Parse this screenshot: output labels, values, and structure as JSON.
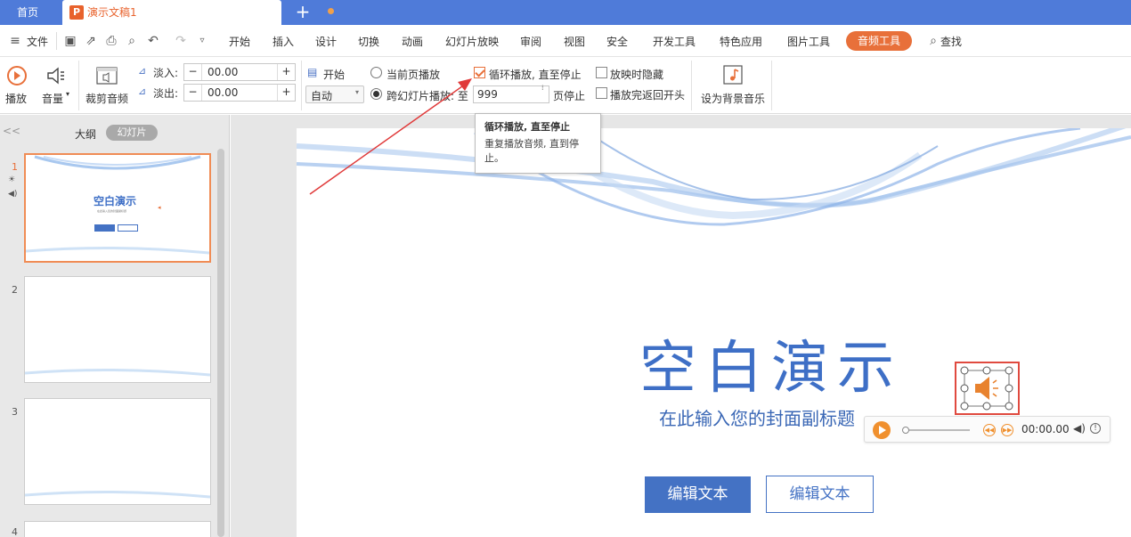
{
  "tabs": {
    "home": "首页",
    "doc_title": "演示文稿1",
    "add": "+"
  },
  "menu": {
    "file": "文件",
    "items": [
      "开始",
      "插入",
      "设计",
      "切换",
      "动画",
      "幻灯片放映",
      "审阅",
      "视图",
      "安全",
      "开发工具",
      "特色应用",
      "图片工具"
    ],
    "active_tab": "音频工具",
    "search": "查找"
  },
  "ribbon": {
    "play": "播放",
    "volume": "音量",
    "trim": "裁剪音频",
    "fade_in_label": "淡入:",
    "fade_in_value": "00.00",
    "fade_out_label": "淡出:",
    "fade_out_value": "00.00",
    "start_label": "开始",
    "start_value": "自动",
    "current_page": "当前页播放",
    "cross_slides": "跨幻灯片播放: 至",
    "cross_slides_value": "999",
    "page_stop": "页停止",
    "loop": "循环播放, 直至停止",
    "hide_during_show": "放映时隐藏",
    "rewind": "播放完返回开头",
    "set_bg_music": "设为背景音乐"
  },
  "tooltip": {
    "title": "循环播放, 直至停止",
    "desc": "重复播放音频, 直到停止。"
  },
  "left_panel": {
    "outline": "大纲",
    "slides": "幻灯片",
    "collapse": "<<",
    "thumbs": [
      {
        "num": "1",
        "title": "空白演示",
        "sub": "在此输入您的封面副标题"
      },
      {
        "num": "2"
      },
      {
        "num": "3"
      },
      {
        "num": "4"
      }
    ]
  },
  "slide": {
    "title": "空白演示",
    "subtitle": "在此输入您的封面副标题",
    "button1": "编辑文本",
    "button2": "编辑文本"
  },
  "player": {
    "time": "00:00.00"
  },
  "colors": {
    "accent": "#e8703a",
    "tabbar": "#4f7bd9",
    "slide_blue": "#4472c4",
    "arrow": "#e03a3a"
  }
}
